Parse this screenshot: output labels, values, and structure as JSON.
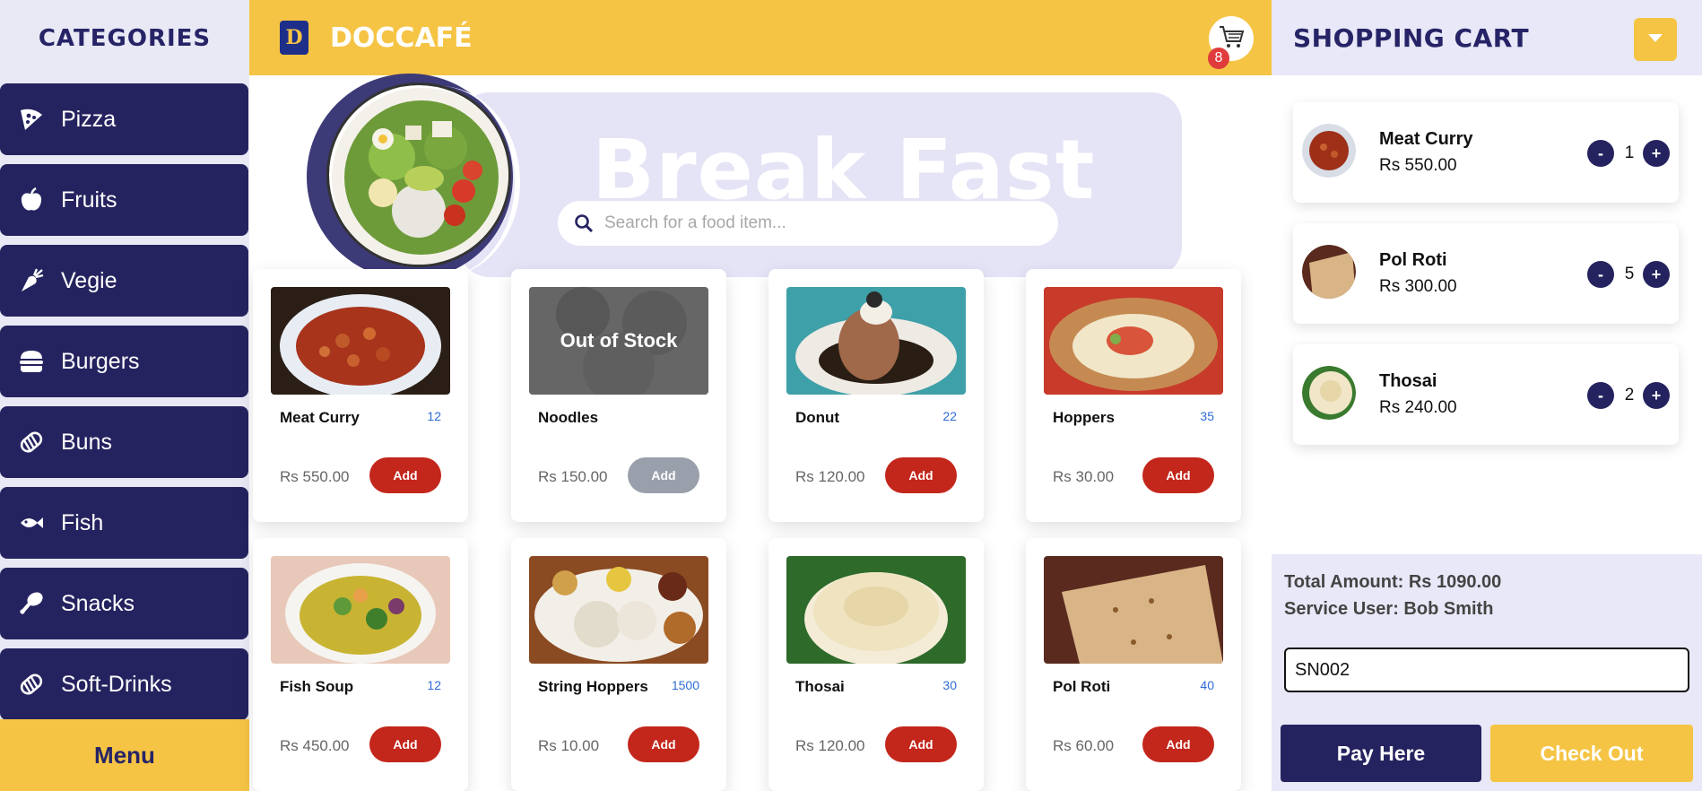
{
  "sidebar": {
    "title": "CATEGORIES",
    "items": [
      {
        "label": "Pizza",
        "icon": "pizza-icon"
      },
      {
        "label": "Fruits",
        "icon": "apple-icon"
      },
      {
        "label": "Vegie",
        "icon": "carrot-icon"
      },
      {
        "label": "Burgers",
        "icon": "burger-icon"
      },
      {
        "label": "Buns",
        "icon": "bread-icon"
      },
      {
        "label": "Fish",
        "icon": "fish-icon"
      },
      {
        "label": "Snacks",
        "icon": "drumstick-icon"
      },
      {
        "label": "Soft-Drinks",
        "icon": "bread-icon"
      }
    ],
    "menu_label": "Menu"
  },
  "header": {
    "brand": "DOCCAFÉ",
    "cart_count": "8"
  },
  "hero": {
    "title": "Break Fast",
    "search_placeholder": "Search for a food item..."
  },
  "products": [
    {
      "name": "Meat Curry",
      "qty": "12",
      "price": "Rs 550.00",
      "add": "Add",
      "in_stock": true,
      "img": "curry"
    },
    {
      "name": "Noodles",
      "qty": "",
      "price": "Rs 150.00",
      "add": "Add",
      "in_stock": false,
      "oos": "Out of Stock",
      "img": "noodles"
    },
    {
      "name": "Donut",
      "qty": "22",
      "price": "Rs 120.00",
      "add": "Add",
      "in_stock": true,
      "img": "donut"
    },
    {
      "name": "Hoppers",
      "qty": "35",
      "price": "Rs 30.00",
      "add": "Add",
      "in_stock": true,
      "img": "hoppers"
    },
    {
      "name": "Fish Soup",
      "qty": "12",
      "price": "Rs 450.00",
      "add": "Add",
      "in_stock": true,
      "img": "soup"
    },
    {
      "name": "String Hoppers",
      "qty": "1500",
      "price": "Rs 10.00",
      "add": "Add",
      "in_stock": true,
      "img": "stringhoppers"
    },
    {
      "name": "Thosai",
      "qty": "30",
      "price": "Rs 120.00",
      "add": "Add",
      "in_stock": true,
      "img": "thosai"
    },
    {
      "name": "Pol Roti",
      "qty": "40",
      "price": "Rs 60.00",
      "add": "Add",
      "in_stock": true,
      "img": "polroti"
    }
  ],
  "cart": {
    "title": "SHOPPING CART",
    "items": [
      {
        "name": "Meat Curry",
        "price": "Rs 550.00",
        "qty": "1"
      },
      {
        "name": "Pol Roti",
        "price": "Rs 300.00",
        "qty": "5"
      },
      {
        "name": "Thosai",
        "price": "Rs 240.00",
        "qty": "2"
      }
    ],
    "minus": "-",
    "plus": "+",
    "total": "Total Amount: Rs 1090.00",
    "service_user": "Service User: Bob Smith",
    "user_id_value": "SN002",
    "pay_label": "Pay Here",
    "checkout_label": "Check Out"
  },
  "colors": {
    "navy": "#25235f",
    "yellow": "#f6c444",
    "lavender": "#e8e8f8",
    "add_red": "#c3261b",
    "qty_blue": "#2f6cd6"
  }
}
